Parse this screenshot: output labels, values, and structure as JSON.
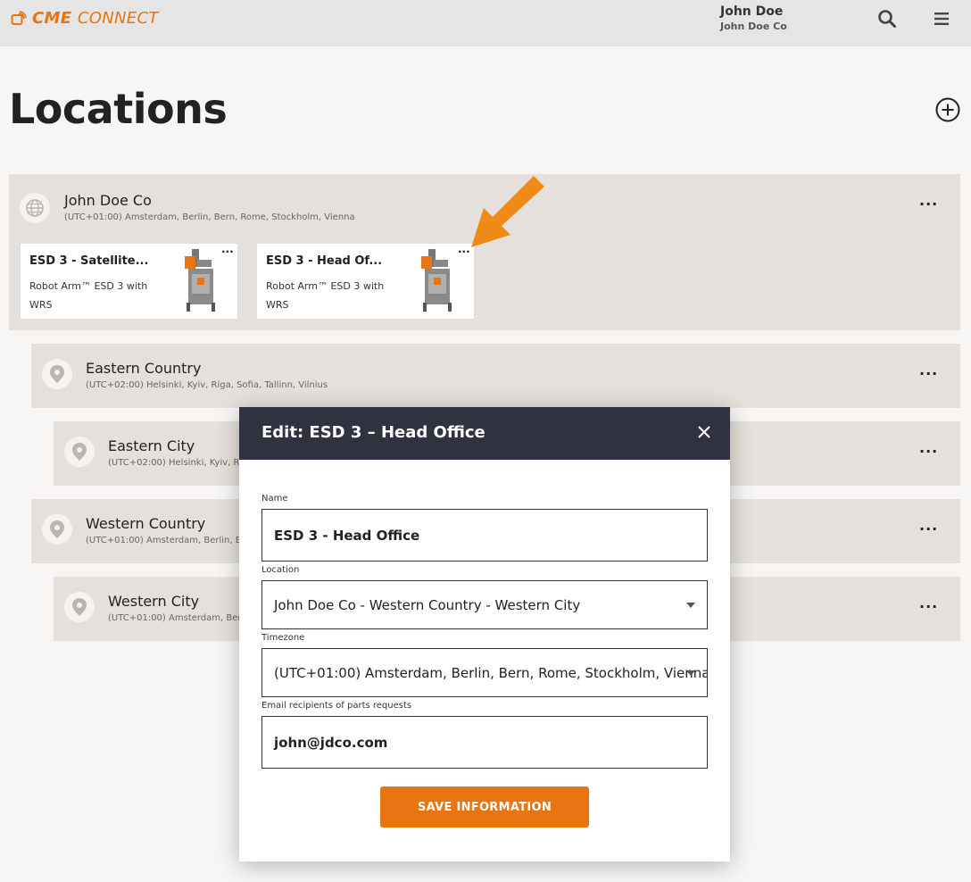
{
  "brand": {
    "name_part1": "CME",
    "name_part2": "CONNECT",
    "accent_color": "#e87511"
  },
  "user": {
    "name": "John Doe",
    "company": "John Doe Co"
  },
  "header_icons": {
    "search": "search-icon",
    "menu": "hamburger-menu-icon"
  },
  "page": {
    "title": "Locations",
    "add_icon": "plus-circle-icon"
  },
  "locations": [
    {
      "name": "John Doe Co",
      "timezone": "(UTC+01:00) Amsterdam, Berlin, Bern, Rome, Stockholm, Vienna",
      "icon": "globe-icon",
      "menu": "···"
    },
    {
      "name": "Eastern Country",
      "timezone": "(UTC+02:00) Helsinki, Kyiv, Riga, Sofia, Tallinn, Vilnius",
      "icon": "map-pin-icon",
      "menu": "···"
    },
    {
      "name": "Eastern City",
      "timezone": "(UTC+02:00) Helsinki, Kyiv, R",
      "icon": "map-pin-icon",
      "menu": "···"
    },
    {
      "name": "Western Country",
      "timezone": "(UTC+01:00) Amsterdam, Berlin, B",
      "icon": "map-pin-icon",
      "menu": "···"
    },
    {
      "name": "Western City",
      "timezone": "(UTC+01:00) Amsterdam, Ber",
      "icon": "map-pin-icon",
      "menu": "···"
    }
  ],
  "machines": [
    {
      "title": "ESD 3 - Satellite...",
      "description": "Robot Arm™ ESD 3 with WRS",
      "menu": "···"
    },
    {
      "title": "ESD 3 - Head Of...",
      "description": "Robot Arm™ ESD 3 with WRS",
      "menu": "···"
    }
  ],
  "modal": {
    "title": "Edit: ESD 3 – Head Office",
    "name_label": "Name",
    "name_value": "ESD 3 - Head Office",
    "location_label": "Location",
    "location_value": "John Doe Co - Western Country - Western City",
    "timezone_label": "Timezone",
    "timezone_value": "(UTC+01:00) Amsterdam, Berlin, Bern, Rome, Stockholm, Vienna",
    "email_label": "Email recipients of parts requests",
    "email_value": "john@jdco.com",
    "save_label": "SAVE INFORMATION"
  }
}
